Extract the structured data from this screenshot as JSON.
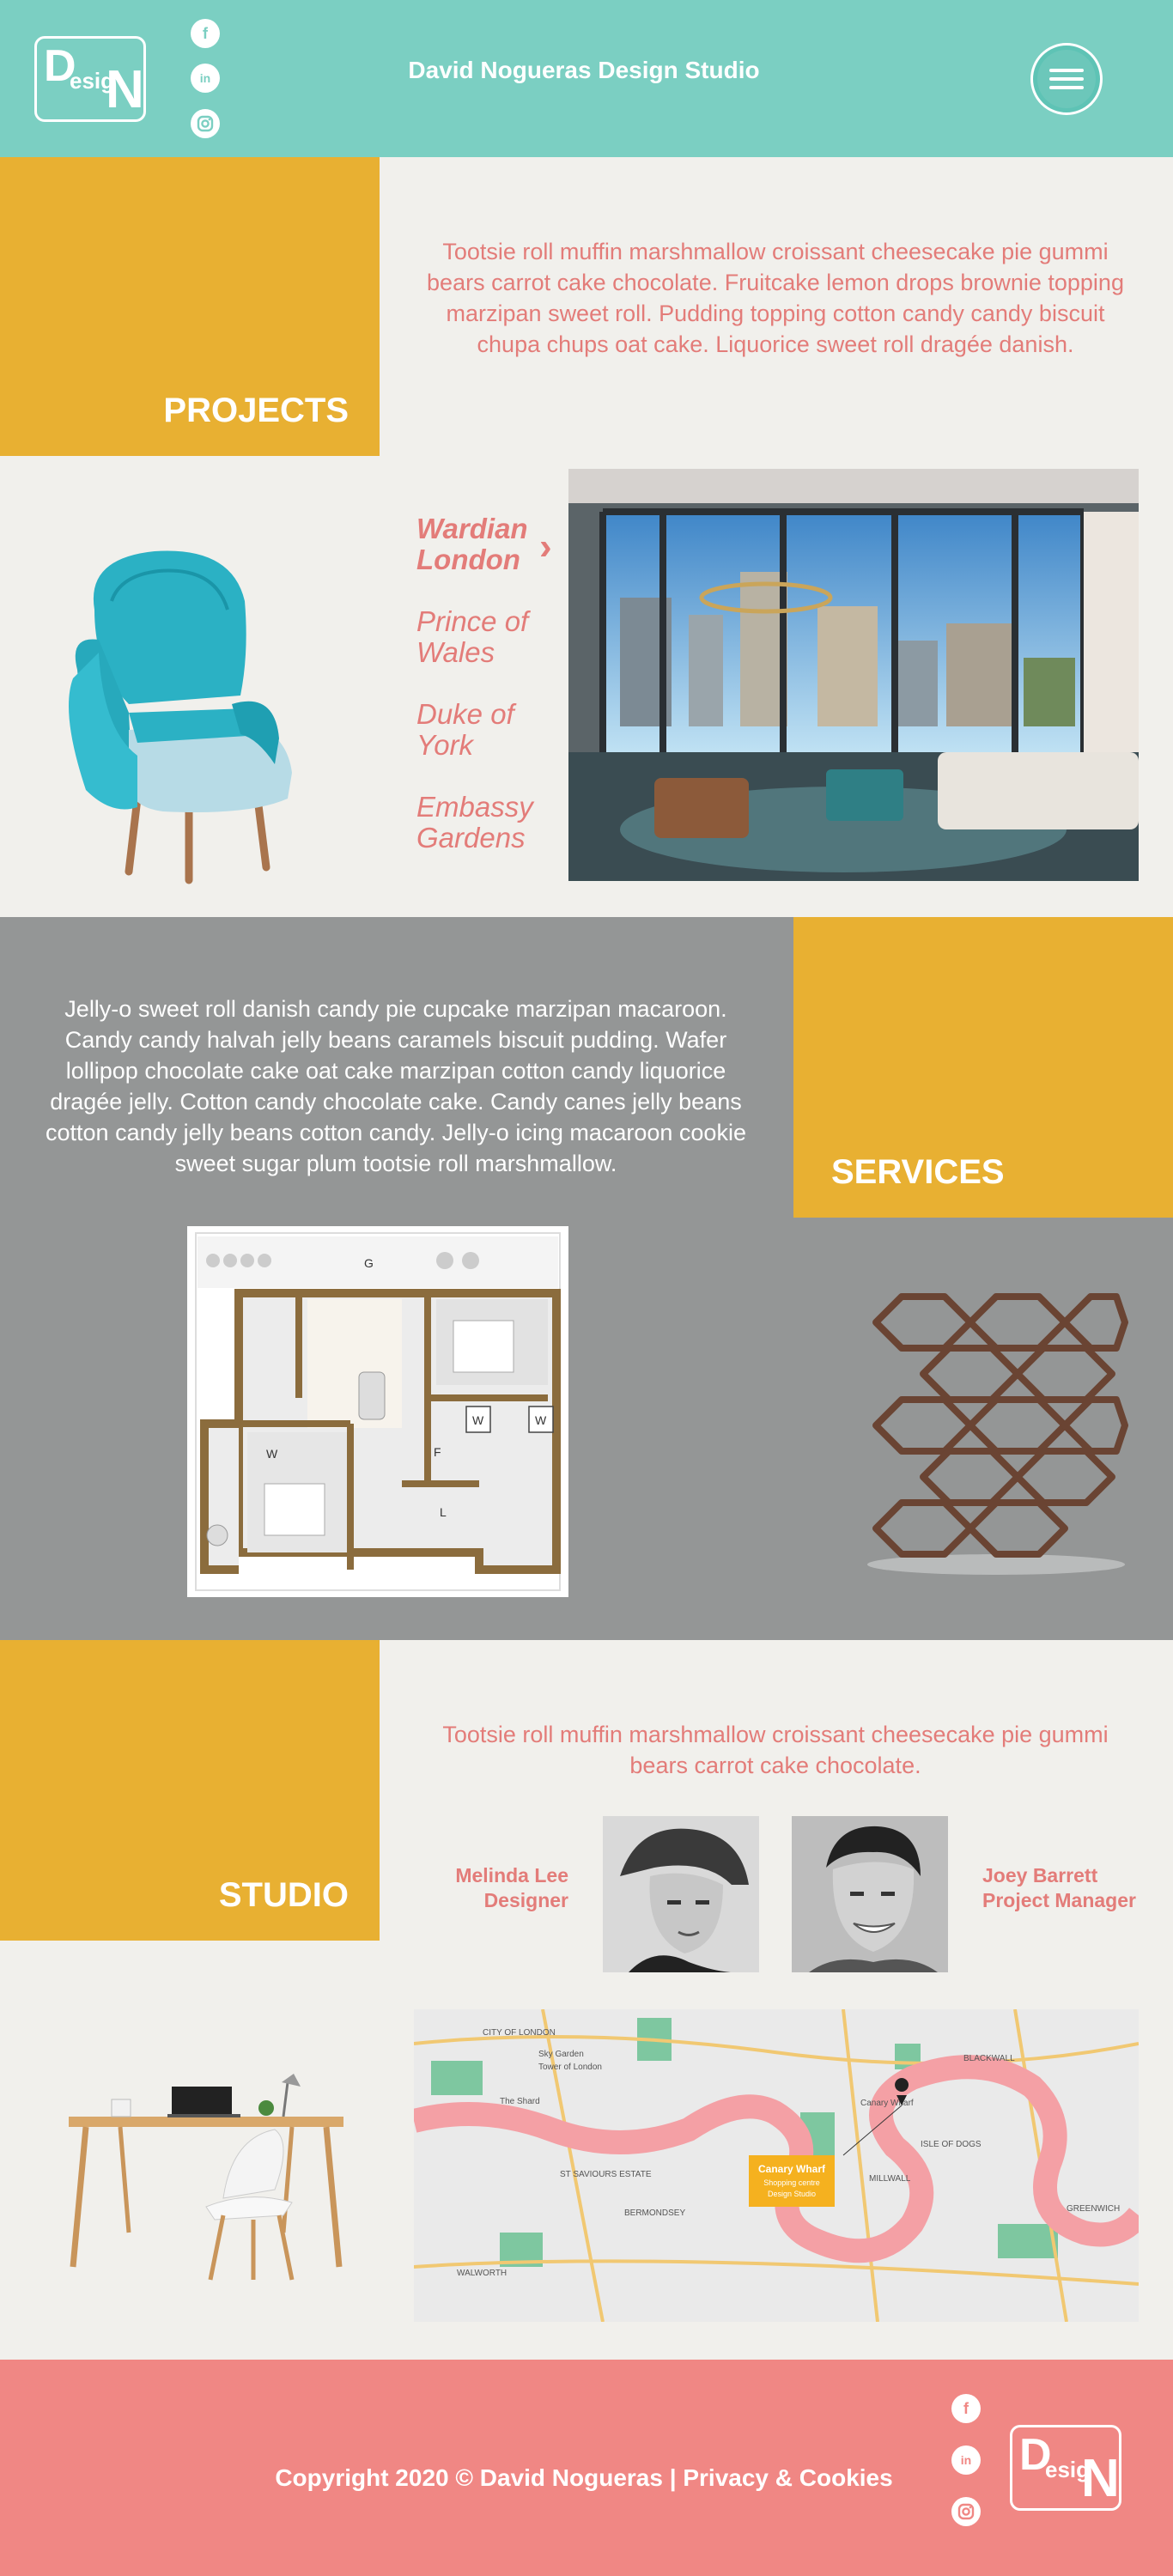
{
  "header": {
    "title": "David Nogueras Design Studio",
    "logo": {
      "part1": "D",
      "part2": "esig",
      "part3": "N"
    },
    "social": [
      "f",
      "in",
      "ig"
    ]
  },
  "projects": {
    "heading": "PROJECTS",
    "intro": "Tootsie roll muffin marshmallow croissant cheesecake pie gummi bears carrot cake chocolate. Fruitcake lemon drops brownie topping marzipan sweet roll. Pudding topping cotton candy candy biscuit chupa chups oat cake. Liquorice sweet roll dragée danish.",
    "items": [
      {
        "line1": "Wardian",
        "line2": "London"
      },
      {
        "line1": "Prince of",
        "line2": "Wales"
      },
      {
        "line1": "Duke of",
        "line2": "York"
      },
      {
        "line1": "Embassy",
        "line2": "Gardens"
      }
    ]
  },
  "services": {
    "heading": "SERVICES",
    "text": "Jelly-o sweet roll danish candy pie cupcake marzipan macaroon. Candy candy halvah jelly beans caramels biscuit pudding. Wafer lollipop chocolate cake oat cake marzipan cotton candy liquorice dragée jelly. Cotton candy chocolate cake. Candy canes jelly beans cotton candy jelly beans cotton candy. Jelly-o icing macaroon cookie sweet sugar plum tootsie roll marshmallow.",
    "floorplan_labels": [
      "G",
      "W",
      "W",
      "W",
      "F",
      "L"
    ]
  },
  "studio": {
    "heading": "STUDIO",
    "intro": "Tootsie roll muffin marshmallow croissant cheesecake pie gummi bears carrot cake chocolate.",
    "people": [
      {
        "name": "Melinda Lee",
        "role": "Designer"
      },
      {
        "name": "Joey Barrett",
        "role": "Project Manager"
      }
    ],
    "map": {
      "labels": [
        "CITY OF LONDON",
        "Sky Garden",
        "Tower of London",
        "The Shard",
        "Canary Wharf",
        "ISLE OF DOGS",
        "MILLWALL",
        "GREENWICH",
        "BERMONDSEY",
        "WALWORTH",
        "ST SAVIOURS ESTATE",
        "BLACKWALL"
      ],
      "callout_title": "Canary Wharf",
      "callout_sub1": "Shopping centre",
      "callout_sub2": "Design Studio"
    }
  },
  "footer": {
    "copyright": "Copyright 2020 © David Nogueras | Privacy & Cookies",
    "social": [
      "f",
      "in",
      "ig"
    ]
  },
  "colors": {
    "teal": "#7bcfc2",
    "yellow": "#e8b032",
    "pink": "#e37c79",
    "footer_pink": "#f08784",
    "grey": "#949696",
    "cream": "#f1f0ec"
  }
}
